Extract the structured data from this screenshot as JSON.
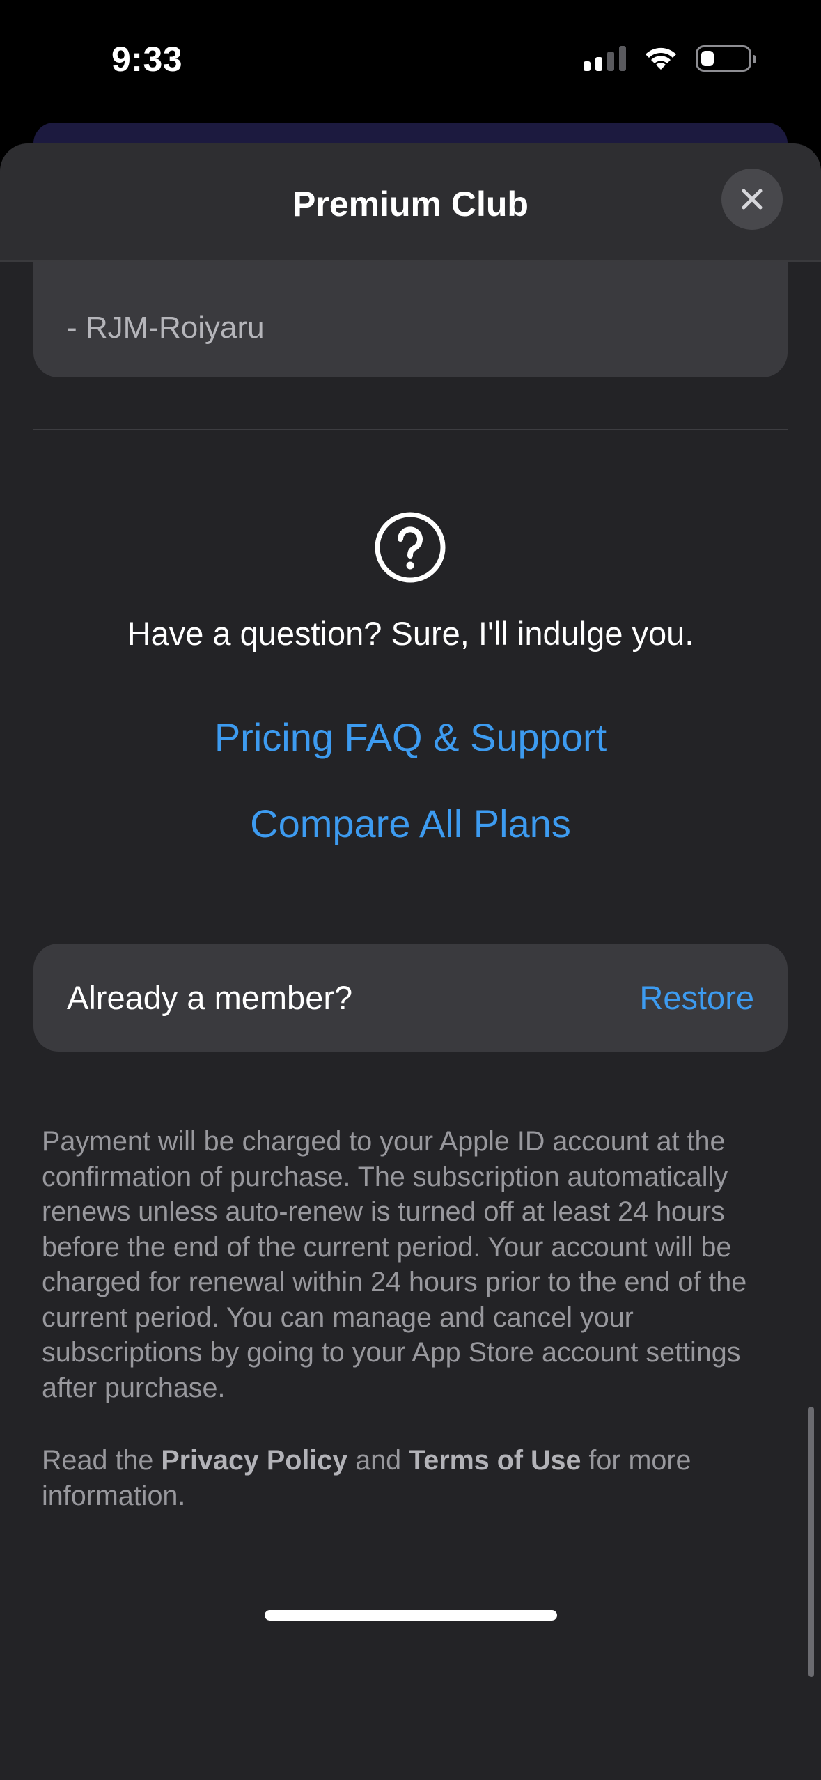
{
  "status_bar": {
    "time": "9:33",
    "icons": [
      "signal-icon",
      "wifi-icon",
      "battery-icon"
    ]
  },
  "sheet": {
    "title": "Premium Club",
    "close_icon": "close-icon"
  },
  "review": {
    "author": "- RJM-Roiyaru"
  },
  "help": {
    "icon": "question-circle-icon",
    "text": "Have a question? Sure, I'll indulge you.",
    "faq_link": "Pricing FAQ & Support",
    "compare_link": "Compare All Plans"
  },
  "member": {
    "label": "Already a member?",
    "restore": "Restore"
  },
  "legal": {
    "payment_text": "Payment will be charged to your Apple ID account at the confirmation of purchase. The subscription automatically renews unless auto-renew is turned off at least 24 hours before the end of the current period. Your account will be charged for renewal within 24 hours prior to the end of the current period. You can manage and cancel your subscriptions by going to your App Store account settings after purchase.",
    "read_the": "Read the",
    "privacy_policy": "Privacy Policy",
    "and": "and",
    "terms_of_use": "Terms of Use",
    "for_more": "for more information."
  },
  "colors": {
    "accent_link": "#3d9bf0",
    "sheet_bg": "#232326",
    "card_bg": "#3a3a3e"
  }
}
